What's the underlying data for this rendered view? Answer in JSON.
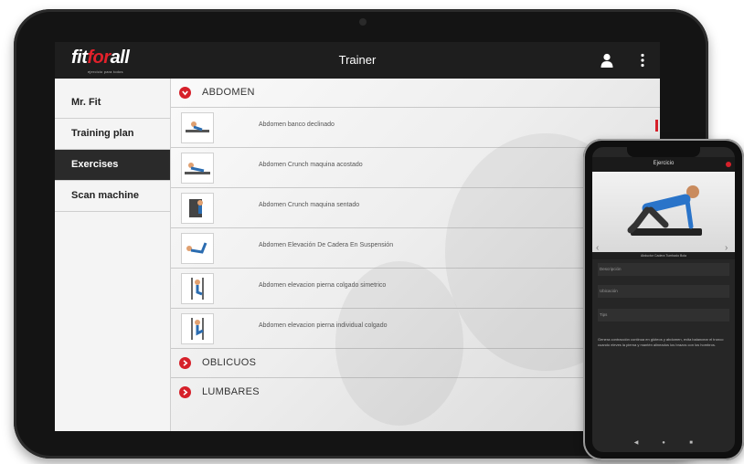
{
  "app": {
    "logo_part1": "fit",
    "logo_part2": "for",
    "logo_part3": "all",
    "logo_tagline": "ejercicio para todos",
    "title": "Trainer"
  },
  "icons": {
    "user": "user-icon",
    "menu": "more-vertical-icon",
    "section_open": "chevron-down-circle-icon",
    "section_closed": "chevron-right-circle-icon",
    "play": "play-circle-icon"
  },
  "colors": {
    "accent": "#d6202a",
    "topbar": "#1e1e1e",
    "active_item": "#2a2a2a"
  },
  "sidebar": {
    "items": [
      {
        "label": "Mr. Fit"
      },
      {
        "label": "Training plan"
      },
      {
        "label": "Exercises"
      },
      {
        "label": "Scan machine"
      }
    ]
  },
  "sections": [
    {
      "label": "ABDOMEN"
    },
    {
      "label": "OBLICUOS"
    },
    {
      "label": "LUMBARES"
    }
  ],
  "exercises": [
    {
      "name": "Abdomen banco declinado"
    },
    {
      "name": "Abdomen Crunch maquina acostado"
    },
    {
      "name": "Abdomen Crunch maquina sentado"
    },
    {
      "name": "Abdomen Elevación De Cadera En Suspensión"
    },
    {
      "name": "Abdomen elevacion pierna colgado simetrico"
    },
    {
      "name": "Abdomen elevacion pierna individual colgado"
    }
  ],
  "phone": {
    "title": "Ejercicio",
    "caption": "Abductor Cadera Tumbado Bola",
    "field1": "Descripción",
    "field2": "Ubicación",
    "field3": "Tips",
    "description": "Genera contracción continua en glúteos y abdomen, evita balancear el tronco cuando eleves la pierna y mantén alineados los brazos con los hombros."
  }
}
